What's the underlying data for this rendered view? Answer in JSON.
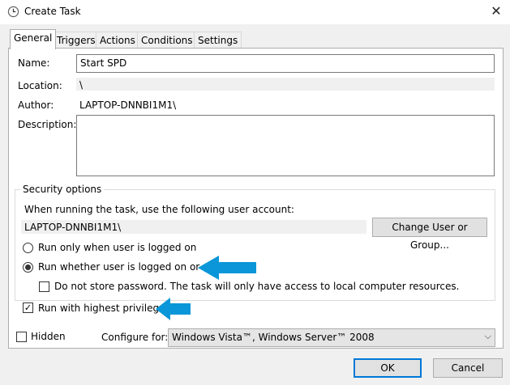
{
  "window": {
    "title": "Create Task",
    "close_icon": "close-icon",
    "title_icon": "clock-icon"
  },
  "tabs": [
    {
      "label": "General",
      "active": true
    },
    {
      "label": "Triggers"
    },
    {
      "label": "Actions"
    },
    {
      "label": "Conditions"
    },
    {
      "label": "Settings"
    }
  ],
  "general": {
    "name_label": "Name:",
    "name_value": "Start SPD",
    "location_label": "Location:",
    "location_value": "\\",
    "author_label": "Author:",
    "author_value": "LAPTOP-DNNBI1M1\\",
    "description_label": "Description:",
    "description_value": ""
  },
  "security": {
    "group_title": "Security options",
    "account_prompt": "When running the task, use the following user account:",
    "account_value": "LAPTOP-DNNBI1M1\\",
    "change_button": "Change User or Group...",
    "radio_logged_on": "Run only when user is logged on",
    "radio_whether": "Run whether user is logged on or not",
    "selected_option": "radio_whether",
    "do_not_store": "Do not store password.  The task will only have access to local computer resources.",
    "do_not_store_checked": false,
    "highest_privileges": "Run with highest privileges",
    "highest_privileges_checked": true
  },
  "footer": {
    "hidden_label": "Hidden",
    "hidden_checked": false,
    "configure_label": "Configure for:",
    "configure_value": "Windows Vista™, Windows Server™ 2008",
    "ok_button": "OK",
    "cancel_button": "Cancel"
  },
  "annotations": {
    "arrow_color": "#0a96d8"
  },
  "colors": {
    "accent": "#0078d7"
  }
}
